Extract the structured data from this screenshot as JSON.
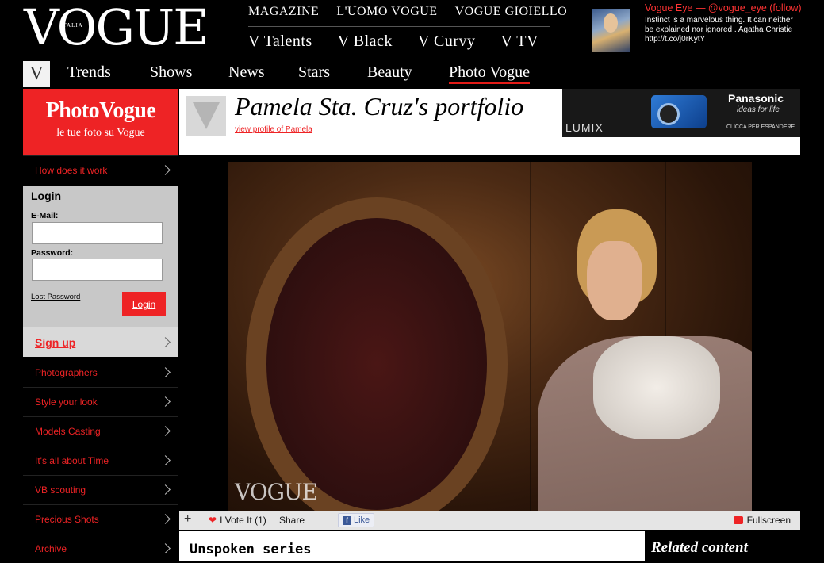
{
  "header": {
    "logo": "VOGUE",
    "logo_sub": "ITALIA",
    "top_links": [
      "MAGAZINE",
      "L'UOMO VOGUE",
      "VOGUE GIOIELLO"
    ],
    "sub_links": [
      "V Talents",
      "V Black",
      "V Curvy",
      "V TV"
    ],
    "vogue_eye": {
      "title": "Vogue Eye — @vogue_eye (follow)",
      "tweet": "Instinct is a marvelous thing. It can neither be explained nor ignored . Agatha Christie http://t.co/j0rKytY"
    }
  },
  "main_nav": {
    "v_label": "V",
    "items": [
      "Trends",
      "Shows",
      "News",
      "Stars",
      "Beauty",
      "Photo Vogue"
    ],
    "active": "Photo Vogue"
  },
  "sidebar": {
    "brand_title": "PhotoVogue",
    "brand_sub": "le tue foto su Vogue",
    "how_it_works": "How does it work",
    "login": {
      "title": "Login",
      "email_label": "E-Mail:",
      "email_value": "",
      "password_label": "Password:",
      "password_value": "",
      "lost_password": "Lost Password",
      "button": "Login"
    },
    "signup": "Sign up",
    "items": [
      "Photographers",
      "Style your look",
      "Models Casting",
      "It's all about Time",
      "VB scouting",
      "Precious Shots",
      "Archive"
    ]
  },
  "portfolio": {
    "title": "Pamela Sta. Cruz's portfolio",
    "profile_link": "view profile of Pamela",
    "photo_watermark": "VOGUE"
  },
  "ad": {
    "product": "LUMIX",
    "brand": "Panasonic",
    "tagline": "ideas for life",
    "cta": "CLICCA PER ESPANDERE"
  },
  "actions": {
    "plus": "+",
    "vote": "I Vote It (1)",
    "share": "Share",
    "like": "Like",
    "fullscreen": "Fullscreen"
  },
  "series_title": "Unspoken series",
  "related_title": "Related content",
  "colors": {
    "brand_red": "#ee2325",
    "background": "#000000"
  }
}
